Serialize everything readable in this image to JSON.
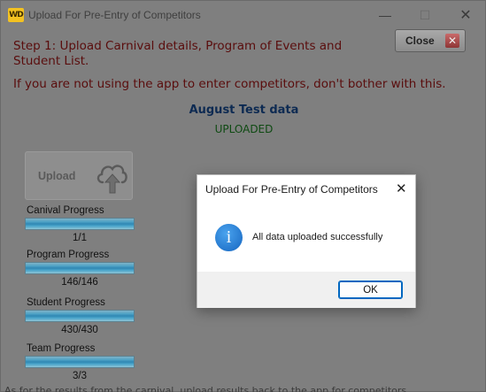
{
  "window": {
    "logo_text": "WD",
    "title": "Upload For Pre-Entry of Competitors",
    "minimize_glyph": "—",
    "maximize_glyph": "☐",
    "close_glyph": "✕"
  },
  "close_button": {
    "label": "Close",
    "icon": "close-x-icon",
    "glyph": "✕"
  },
  "instructions": {
    "step": "Step 1: Upload Carnival details, Program of Events and Student List.",
    "warning": "If you are not using the app to enter competitors, don't bother with this."
  },
  "carnival": {
    "name": "August Test data",
    "status": "UPLOADED"
  },
  "upload_button": {
    "label": "Upload",
    "icon": "cloud-upload-icon"
  },
  "progress": [
    {
      "label": "Canival Progress",
      "count": "1/1",
      "fraction": 1.0
    },
    {
      "label": "Program Progress",
      "count": "146/146",
      "fraction": 1.0
    },
    {
      "label": "Student Progress",
      "count": "430/430",
      "fraction": 1.0
    },
    {
      "label": "Team Progress",
      "count": "3/3",
      "fraction": 1.0
    }
  ],
  "footer_text": "As for the results from the carnival, upload results back to the app for competitors",
  "dialog": {
    "title": "Upload For Pre-Entry of Competitors",
    "close_glyph": "✕",
    "icon": "info-icon",
    "icon_glyph": "i",
    "message": "All data uploaded successfully",
    "ok_label": "OK"
  },
  "colors": {
    "instruction_text": "#5a0d0d",
    "carnival_name": "#0d2a52",
    "status_text": "#0e4a12",
    "dialog_accent": "#0067c0",
    "info_icon": "#1e78d6"
  }
}
